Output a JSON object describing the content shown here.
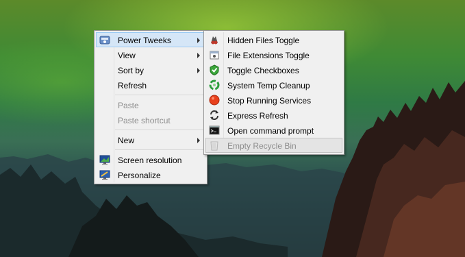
{
  "main_menu": {
    "items": [
      {
        "label": "Power Tweeks",
        "icon": "power-tweeks-icon",
        "submenu": true,
        "highlighted": true
      },
      {
        "label": "View",
        "submenu": true
      },
      {
        "label": "Sort by",
        "submenu": true
      },
      {
        "label": "Refresh"
      },
      {
        "label": "Paste",
        "disabled": true
      },
      {
        "label": "Paste shortcut",
        "disabled": true
      },
      {
        "label": "New",
        "submenu": true
      },
      {
        "label": "Screen resolution",
        "icon": "screen-resolution-icon"
      },
      {
        "label": "Personalize",
        "icon": "personalize-icon"
      }
    ]
  },
  "submenu": {
    "items": [
      {
        "label": "Hidden Files Toggle",
        "icon": "hidden-files-icon"
      },
      {
        "label": "File Extensions Toggle",
        "icon": "file-extensions-icon"
      },
      {
        "label": "Toggle Checkboxes",
        "icon": "shield-check-icon"
      },
      {
        "label": "System Temp Cleanup",
        "icon": "recycle-cleanup-icon"
      },
      {
        "label": "Stop Running Services",
        "icon": "stop-icon"
      },
      {
        "label": "Express Refresh",
        "icon": "refresh-icon"
      },
      {
        "label": "Open command prompt",
        "icon": "command-prompt-icon"
      },
      {
        "label": "Empty Recycle Bin",
        "icon": "recycle-bin-icon",
        "disabled": true,
        "highlighted": true
      }
    ]
  },
  "colors": {
    "menu_bg": "#f0f0f0",
    "highlight": "#d5e6f7",
    "highlight_border": "#99c9f3",
    "disabled_text": "#8d8d8d"
  }
}
